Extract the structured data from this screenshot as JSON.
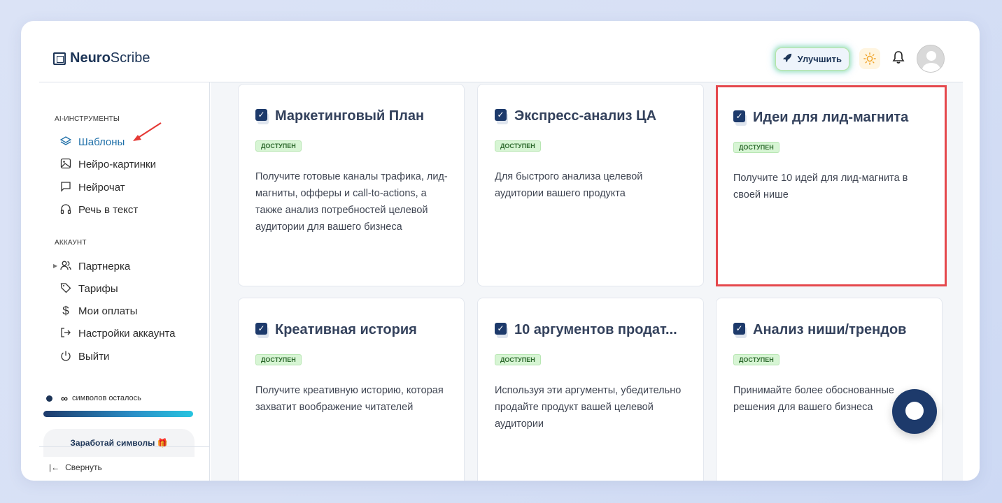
{
  "app": {
    "logo_bold": "Neuro",
    "logo_rest": "Scribe"
  },
  "header": {
    "upgrade_label": "Улучшить"
  },
  "sidebar": {
    "ai_section_title": "AI-ИНСТРУМЕНТЫ",
    "ai_items": [
      {
        "label": "Шаблоны",
        "icon": "layers-icon",
        "active": true
      },
      {
        "label": "Нейро-картинки",
        "icon": "image-icon"
      },
      {
        "label": "Нейрочат",
        "icon": "chat-icon"
      },
      {
        "label": "Речь в текст",
        "icon": "headphones-icon"
      }
    ],
    "account_section_title": "АККАУНТ",
    "account_items": [
      {
        "label": "Партнерка",
        "icon": "users-icon"
      },
      {
        "label": "Тарифы",
        "icon": "tag-icon"
      },
      {
        "label": "Мои оплаты",
        "icon": "dollar-icon"
      },
      {
        "label": "Настройки аккаунта",
        "icon": "logout-arrow-icon"
      },
      {
        "label": "Выйти",
        "icon": "power-icon"
      }
    ],
    "credits_symbol": "∞",
    "credits_text": "символов осталось",
    "credits_fraction": 1.0,
    "earn_label": "Заработай символы 🎁",
    "collapse_label": "Свернуть"
  },
  "cards": [
    {
      "title": "Маркетинговый План",
      "badge": "ДОСТУПЕН",
      "desc": "Получите готовые каналы трафика, лид-магниты, офферы и call-to-actions, а также анализ потребностей целевой аудитории для вашего бизнеса"
    },
    {
      "title": "Экспресс-анализ ЦА",
      "badge": "ДОСТУПЕН",
      "desc": "Для быстрого анализа целевой аудитории вашего продукта"
    },
    {
      "title": "Идеи для лид-магнита",
      "badge": "ДОСТУПЕН",
      "desc": "Получите 10 идей для лид-магнита в своей нише"
    },
    {
      "title": "Креативная история",
      "badge": "ДОСТУПЕН",
      "desc": "Получите креативную историю, которая захватит воображение читателей"
    },
    {
      "title": "10 аргументов продат...",
      "badge": "ДОСТУПЕН",
      "desc": "Используя эти аргументы, убедительно продайте продукт вашей целевой аудитории"
    },
    {
      "title": "Анализ ниши/трендов",
      "badge": "ДОСТУПЕН",
      "desc": "Принимайте более обоснованные решения для вашего бизнеса"
    }
  ],
  "colors": {
    "accent": "#1e6fa8",
    "brand_dark": "#1d3a6b",
    "highlight": "#e5484d",
    "badge_bg": "#d7f5d4"
  }
}
